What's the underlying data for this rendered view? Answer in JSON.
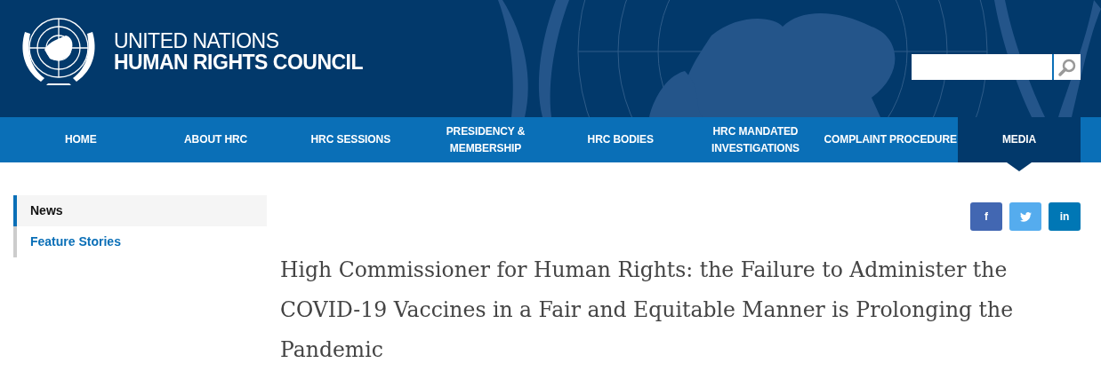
{
  "header": {
    "logo_line_1": "UNITED NATIONS",
    "logo_line_2": "HUMAN RIGHTS COUNCIL"
  },
  "nav": [
    {
      "label": "HOME",
      "selected": false
    },
    {
      "label": "ABOUT HRC",
      "selected": false
    },
    {
      "label": "HRC SESSIONS",
      "selected": false
    },
    {
      "label": "PRESIDENCY & MEMBERSHIP",
      "selected": false
    },
    {
      "label": "HRC BODIES",
      "selected": false
    },
    {
      "label": "HRC MANDATED INVESTIGATIONS",
      "selected": false
    },
    {
      "label": "COMPLAINT PROCEDURE",
      "selected": false
    },
    {
      "label": "MEDIA",
      "selected": true
    }
  ],
  "sidebar": {
    "items": [
      {
        "label": "News",
        "selected": true
      },
      {
        "label": "Feature Stories",
        "selected": false
      }
    ]
  },
  "share_buttons": [
    {
      "kind": "facebook",
      "label": "f",
      "color": "#4267b2"
    },
    {
      "kind": "twitter",
      "color": "#55acee"
    },
    {
      "kind": "linkedin",
      "label": "in",
      "color": "#0077b5"
    }
  ],
  "article": {
    "title": "High Commissioner for Human Rights: the Failure to Administer the COVID-19 Vaccines in a Fair and Equitable Manner is Prolonging the Pandemic"
  }
}
